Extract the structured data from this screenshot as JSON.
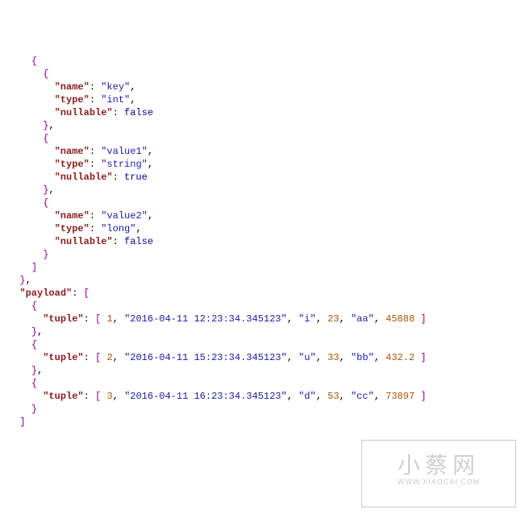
{
  "code": {
    "schema_fields": [
      {
        "name": "key",
        "type": "int",
        "nullable": false
      },
      {
        "name": "value1",
        "type": "string",
        "nullable": true
      },
      {
        "name": "value2",
        "type": "long",
        "nullable": false
      }
    ],
    "payload_key": "payload",
    "field_labels": {
      "name": "name",
      "type": "type",
      "nullable": "nullable",
      "tuple": "tuple"
    },
    "payload": [
      {
        "tuple": [
          1,
          "2016-04-11 12:23:34.345123",
          "i",
          23,
          "aa",
          45888
        ]
      },
      {
        "tuple": [
          2,
          "2016-04-11 15:23:34.345123",
          "u",
          33,
          "bb",
          432.2
        ]
      },
      {
        "tuple": [
          3,
          "2016-04-11 16:23:34.345123",
          "d",
          53,
          "cc",
          73897
        ]
      }
    ]
  },
  "watermark": {
    "text": "小蔡网",
    "url": "WWW.XIAOCAI.COM"
  }
}
